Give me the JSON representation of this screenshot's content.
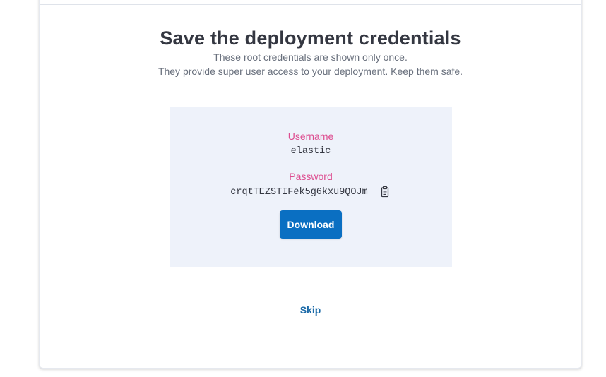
{
  "header": {
    "title": "Save the deployment credentials",
    "subtitle_line1": "These root credentials are shown only once.",
    "subtitle_line2": "They provide super user access to your deployment. Keep them safe."
  },
  "credentials": {
    "username_label": "Username",
    "username_value": "elastic",
    "password_label": "Password",
    "password_value": "crqtTEZSTIFek5g6kxu9QOJm",
    "copy_icon": "clipboard-icon"
  },
  "actions": {
    "download_label": "Download",
    "skip_label": "Skip"
  },
  "colors": {
    "label_pink": "#dd4c8f",
    "button_blue": "#0a6fc2",
    "link_blue": "#1b6aa8",
    "box_background": "#eef2fa"
  }
}
